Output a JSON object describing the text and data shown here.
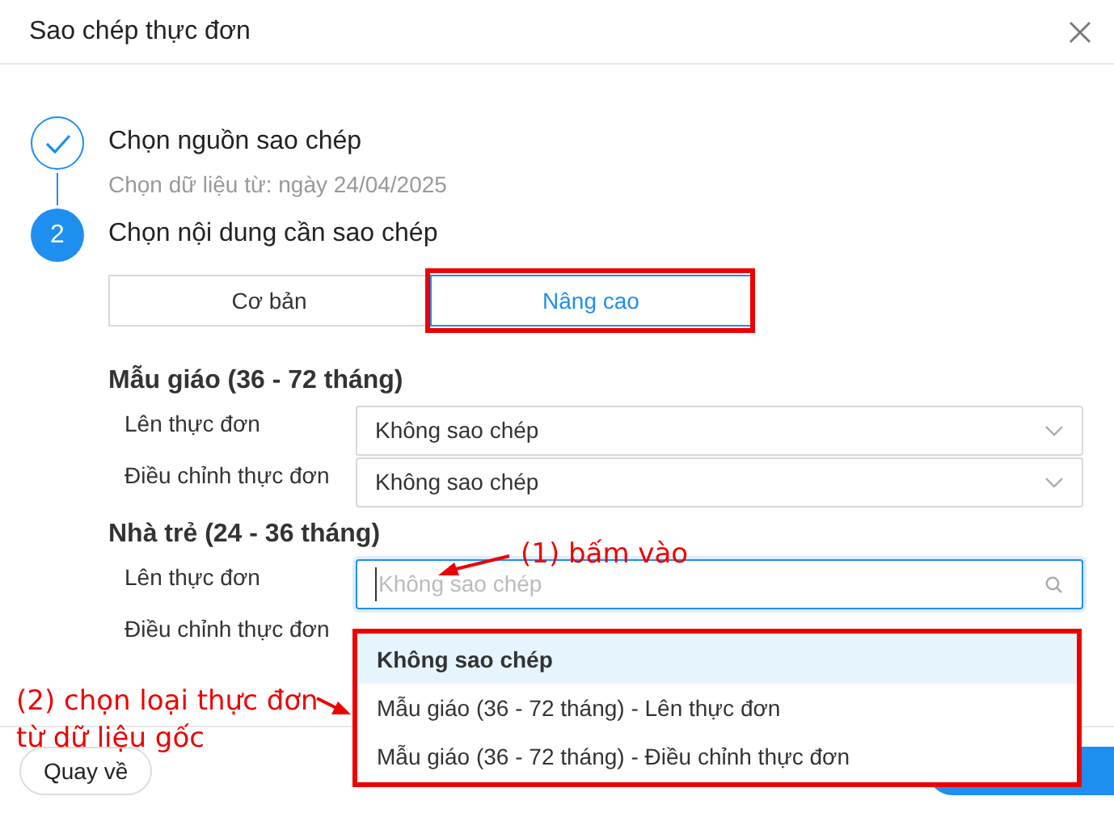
{
  "dialog": {
    "title": "Sao chép thực đơn"
  },
  "steps": [
    {
      "done": true,
      "title": "Chọn nguồn sao chép",
      "subtitle": "Chọn dữ liệu từ: ngày 24/04/2025"
    },
    {
      "done": false,
      "number": "2",
      "title": "Chọn nội dung cần sao chép"
    }
  ],
  "mode_tabs": [
    {
      "label": "Cơ bản",
      "selected": false
    },
    {
      "label": "Nâng cao",
      "selected": true
    }
  ],
  "sections": [
    {
      "heading": "Mẫu giáo (36 - 72 tháng)",
      "rows": [
        {
          "label": "Lên thực đơn",
          "value": "Không sao chép",
          "focused": false
        },
        {
          "label": "Điều chỉnh thực đơn",
          "value": "Không sao chép",
          "focused": false
        }
      ]
    },
    {
      "heading": "Nhà trẻ (24 - 36 tháng)",
      "rows": [
        {
          "label": "Lên thực đơn",
          "placeholder": "Không sao chép",
          "focused": true
        },
        {
          "label": "Điều chỉnh thực đơn"
        }
      ]
    }
  ],
  "dropdown": {
    "options": [
      {
        "label": "Không sao chép",
        "selected": true
      },
      {
        "label": "Mẫu giáo (36 - 72 tháng) - Lên thực đơn",
        "selected": false
      },
      {
        "label": "Mẫu giáo (36 - 72 tháng) - Điều chỉnh thực đơn",
        "selected": false
      }
    ]
  },
  "annotations": [
    {
      "text": "(1) bấm vào"
    },
    {
      "text": "(2) chọn loại thực đơn\ntừ dữ liệu gốc"
    }
  ],
  "footer": {
    "back_button": "Quay về"
  }
}
